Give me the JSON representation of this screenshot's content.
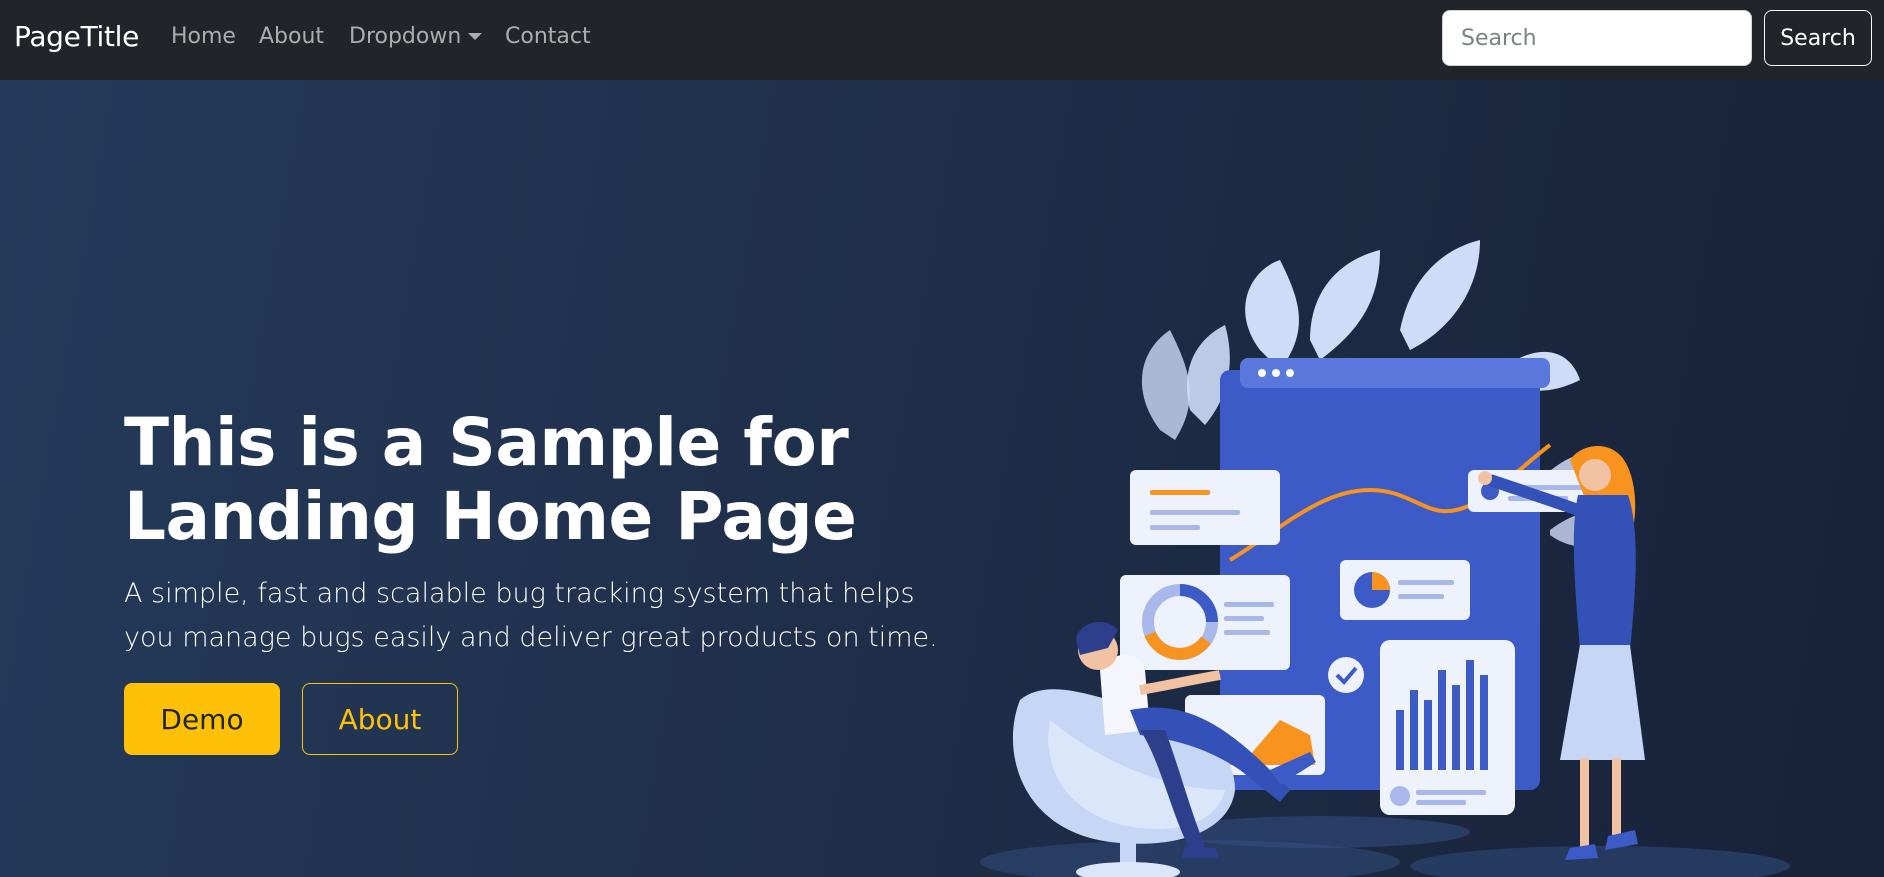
{
  "navbar": {
    "brand": "PageTitle",
    "links": [
      {
        "label": "Home"
      },
      {
        "label": "About"
      },
      {
        "label": "Dropdown"
      },
      {
        "label": "Contact"
      }
    ],
    "search": {
      "placeholder": "Search",
      "value": "",
      "button_label": "Search"
    }
  },
  "hero": {
    "title": "This is a Sample for Landing Home Page",
    "subtitle": "A simple, fast and scalable bug tracking system that helps you manage bugs easily and deliver great products on time.",
    "primary_button": "Demo",
    "secondary_button": "About",
    "illustration": "analytics-dashboard-illustration"
  },
  "colors": {
    "navbar_bg": "#212529",
    "hero_bg": "#1f2f4a",
    "accent": "#ffc107",
    "illustration_primary": "#3d5bc7",
    "illustration_highlight": "#f7931e"
  }
}
